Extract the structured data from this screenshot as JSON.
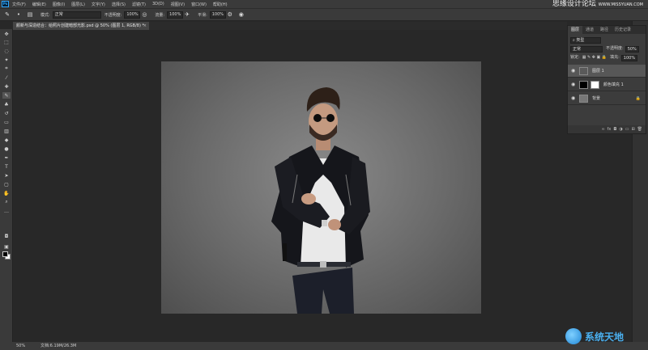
{
  "menubar": {
    "logo": "Ps",
    "items": [
      "文件(F)",
      "编辑(E)",
      "图像(I)",
      "图层(L)",
      "文字(Y)",
      "选择(S)",
      "滤镜(T)",
      "3D(D)",
      "视图(V)",
      "窗口(W)",
      "帮助(H)"
    ],
    "watermark": "思缘设计论坛",
    "watermark_url": "WWW.MISSYUAN.COM"
  },
  "options": {
    "mode_label": "模式:",
    "mode_value": "正常",
    "opacity_label": "不透明度:",
    "opacity_value": "100%",
    "flow_label": "流量:",
    "flow_value": "100%",
    "smoothing_label": "平滑:",
    "smoothing_value": "100%"
  },
  "document_tab": {
    "title": "颜新与深造结合：给照片创建暗部光影.psd @ 50% (图层 1, RGB/8) *",
    "close": "×"
  },
  "layers_panel": {
    "tabs": [
      "图层",
      "通道",
      "路径",
      "历史记录"
    ],
    "active_tab": 0,
    "filter_kind": "类型",
    "blend_mode": "正常",
    "opacity_label": "不透明度:",
    "opacity_value": "50%",
    "lock_label": "锁定:",
    "fill_label": "填充:",
    "fill_value": "100%",
    "layers": [
      {
        "name": "图层 1",
        "selected": true,
        "thumb": "person"
      },
      {
        "name": "颜色填充 1",
        "selected": false,
        "thumb": "black",
        "mask": "white"
      },
      {
        "name": "背景",
        "selected": false,
        "thumb": "photo",
        "locked": true
      }
    ],
    "footer_icons": [
      "link-icon",
      "fx-icon",
      "mask-icon",
      "adjustment-icon",
      "folder-icon",
      "new-layer-icon",
      "trash-icon"
    ]
  },
  "statusbar": {
    "zoom": "50%",
    "docinfo": "文档:6.19M/26.3M"
  },
  "watermark_bottom": "系统天地"
}
